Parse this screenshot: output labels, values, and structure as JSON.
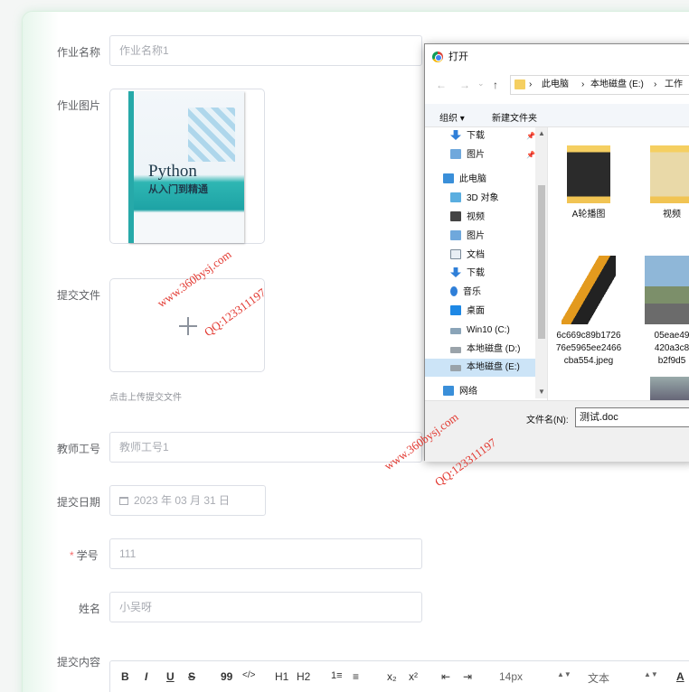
{
  "form": {
    "homework_name": {
      "label": "作业名称",
      "placeholder": "作业名称1"
    },
    "homework_image": {
      "label": "作业图片",
      "book_title": "Python",
      "book_subtitle": "从入门到精通"
    },
    "submit_file": {
      "label": "提交文件",
      "hint": "点击上传提交文件"
    },
    "teacher_id": {
      "label": "教师工号",
      "placeholder": "教师工号1"
    },
    "submit_date": {
      "label": "提交日期",
      "value": "2023 年 03 月 31 日"
    },
    "student_id": {
      "label": "学号",
      "required_mark": "*",
      "value": "111"
    },
    "name": {
      "label": "姓名",
      "value": "小吴呀"
    },
    "content": {
      "label": "提交内容"
    }
  },
  "editor_toolbar": {
    "bold": "B",
    "italic": "I",
    "underline": "U",
    "strike": "S",
    "quote": "99",
    "code": "</>",
    "h1": "H1",
    "h2": "H2",
    "ordered_list": "1≡",
    "bullet_list": "≡",
    "subscript": "x₂",
    "superscript": "x²",
    "outdent": "⇤",
    "indent": "⇥",
    "font_size": "14px",
    "text_style": "文本",
    "font_color": "A"
  },
  "watermarks": {
    "url": "www.360bysj.com",
    "qq": "QQ:123311197"
  },
  "dialog": {
    "title": "打开",
    "path": [
      "此电脑",
      "本地磁盘 (E:)",
      "工作"
    ],
    "organize": "组织",
    "new_folder": "新建文件夹",
    "nav_items": [
      {
        "label": "下载",
        "icon": "download-icon"
      },
      {
        "label": "图片",
        "icon": "pictures-icon"
      },
      {
        "label": "此电脑",
        "icon": "computer-icon"
      },
      {
        "label": "3D 对象",
        "icon": "3d-objects-icon"
      },
      {
        "label": "视频",
        "icon": "video-icon"
      },
      {
        "label": "图片",
        "icon": "pictures-icon"
      },
      {
        "label": "文档",
        "icon": "document-icon"
      },
      {
        "label": "下载",
        "icon": "download-icon"
      },
      {
        "label": "音乐",
        "icon": "music-icon"
      },
      {
        "label": "桌面",
        "icon": "desktop-icon"
      },
      {
        "label": "Win10 (C:)",
        "icon": "drive-c-icon"
      },
      {
        "label": "本地磁盘 (D:)",
        "icon": "drive-icon"
      },
      {
        "label": "本地磁盘 (E:)",
        "icon": "drive-icon"
      },
      {
        "label": "网络",
        "icon": "network-icon"
      }
    ],
    "files": [
      {
        "name": "A轮播图",
        "type": "folder"
      },
      {
        "name": "视频",
        "type": "folder"
      },
      {
        "name": "6c669c89b172676e5965ee2466cba554.jpeg",
        "name_lines": [
          "6c669c89b1726",
          "76e5965ee2466",
          "cba554.jpeg"
        ],
        "type": "image"
      },
      {
        "name": "05eae49 420a3c8 b2f9d5",
        "name_lines": [
          "05eae49",
          "420a3c8",
          "b2f9d5"
        ],
        "type": "image"
      }
    ],
    "filename_label": "文件名(N):",
    "filename_value": "测试.doc"
  }
}
